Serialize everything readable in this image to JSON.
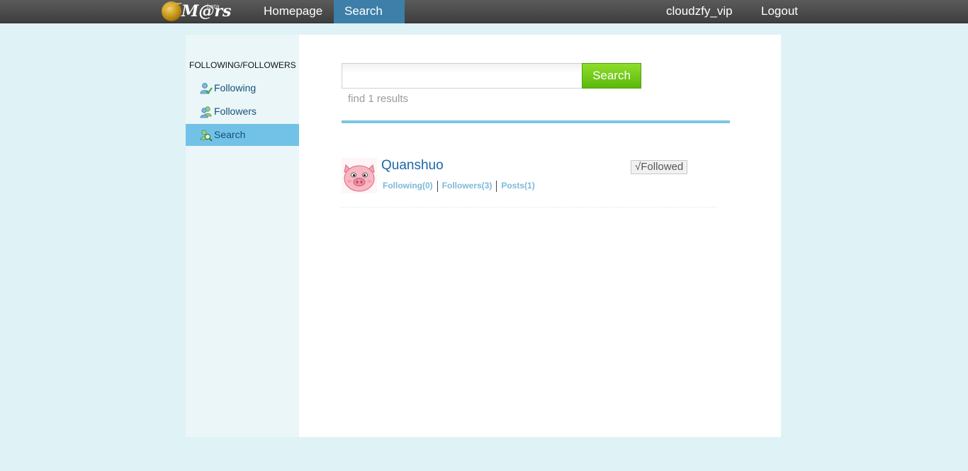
{
  "nav": {
    "logo_text": "M@rs",
    "logo_beta": "beta",
    "homepage_label": "Homepage",
    "search_label": "Search",
    "username": "cloudzfy_vip",
    "logout_label": "Logout"
  },
  "sidebar": {
    "heading": "FOLLOWING/FOLLOWERS",
    "items": [
      {
        "label": "Following",
        "icon": "user-check-icon"
      },
      {
        "label": "Followers",
        "icon": "users-icon"
      },
      {
        "label": "Search",
        "icon": "user-search-icon",
        "active": true
      }
    ]
  },
  "search": {
    "input_value": "",
    "placeholder": "",
    "button_label": "Search",
    "result_count_text": "find 1 results"
  },
  "results": [
    {
      "name": "Quanshuo",
      "avatar": "pig-avatar",
      "following_label": "Following(0)",
      "followers_label": "Followers(3)",
      "posts_label": "Posts(1)",
      "followed_label": "√Followed"
    }
  ],
  "colors": {
    "page_bg": "#dff2f5",
    "topbar": "#4a4a4a",
    "nav_active": "#3d7fa8",
    "sidebar_active": "#72c2e8",
    "search_button": "#6cc61a",
    "accent_rule": "#7cc4e6",
    "username_link": "#1a66a8"
  }
}
